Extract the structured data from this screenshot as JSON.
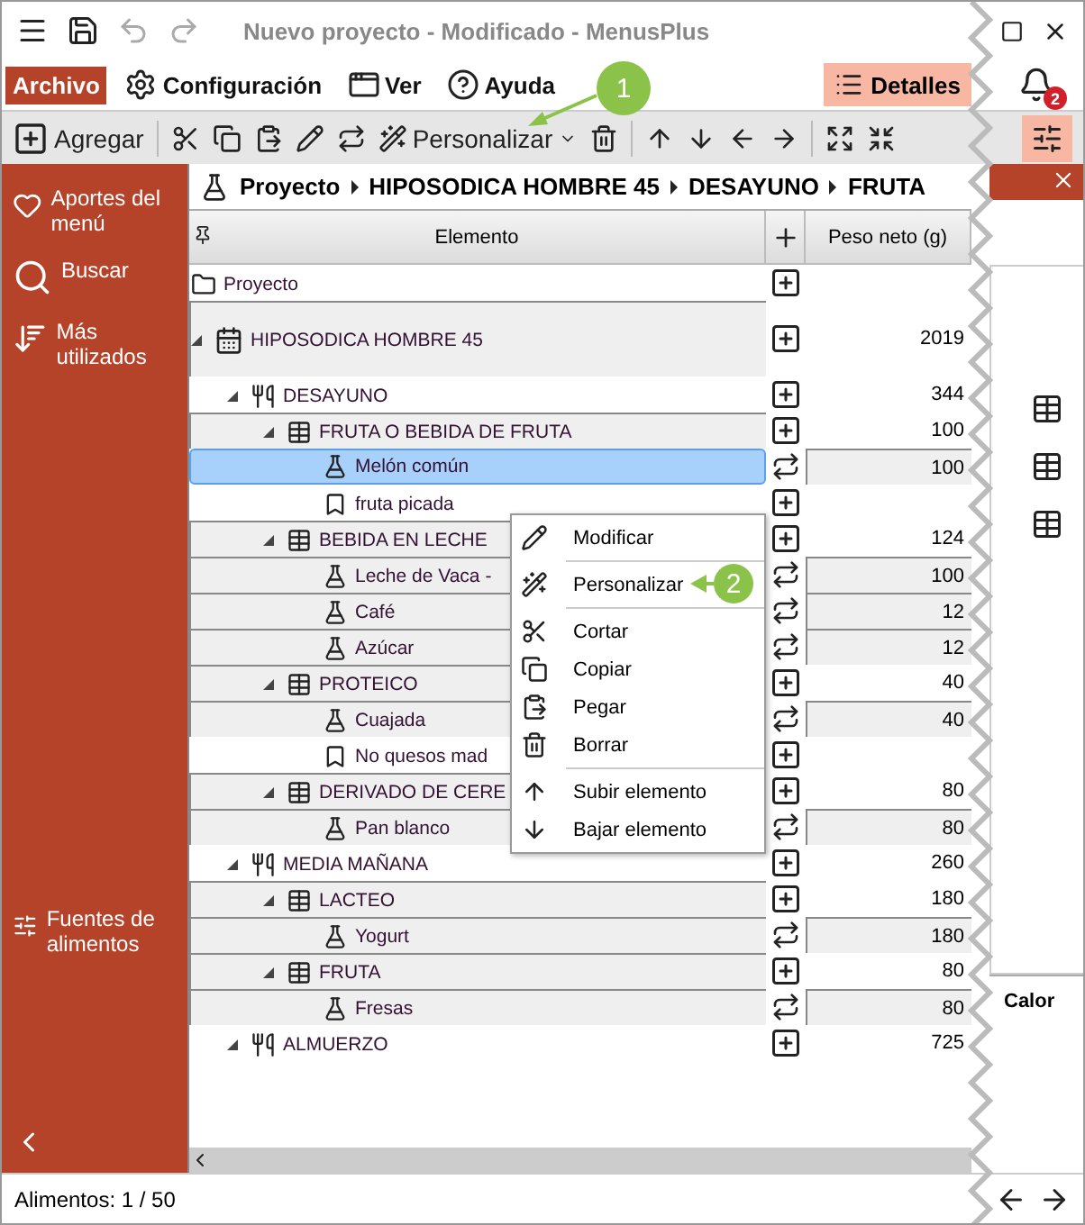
{
  "window": {
    "title": "Nuevo proyecto - Modificado - MenusPlus"
  },
  "menu_bar": {
    "items": [
      {
        "label": "Archivo",
        "selected": true
      },
      {
        "label": "Configuración",
        "selected": false
      },
      {
        "label": "Ver",
        "selected": false
      },
      {
        "label": "Ayuda",
        "selected": false
      }
    ],
    "details_button": {
      "label": "Detalles",
      "selected": true
    },
    "notifications_badge": "2"
  },
  "toolbar": {
    "add_label": "Agregar",
    "customize_label": "Personalizar",
    "settings_selected": true
  },
  "sidebar": {
    "items": [
      {
        "label": "Aportes del menú"
      },
      {
        "label": "Buscar"
      },
      {
        "label": "Más utilizados"
      }
    ],
    "bottom_item": {
      "label": "Fuentes de alimentos"
    }
  },
  "breadcrumb": [
    "Proyecto",
    "HIPOSODICA HOMBRE 45",
    "DESAYUNO",
    "FRUTA"
  ],
  "table": {
    "columns": [
      "Elemento",
      "Peso neto (g)"
    ],
    "rows": [
      {
        "kind": "project",
        "label": "Proyecto",
        "selected": false
      },
      {
        "kind": "menu",
        "label": "HIPOSODICA HOMBRE 45",
        "weight": "2019",
        "selected": false,
        "expanded": true,
        "children": [
          {
            "kind": "meal",
            "label": "DESAYUNO",
            "weight": "344",
            "selected": false,
            "expanded": true,
            "children": [
              {
                "kind": "group",
                "label": "FRUTA O BEBIDA DE FRUTA",
                "weight": "100",
                "selected": false,
                "expanded": true,
                "children": [
                  {
                    "kind": "food",
                    "label": "Melón común",
                    "weight": "100",
                    "selected": true
                  },
                  {
                    "kind": "note",
                    "label": "fruta picada",
                    "selected": false
                  }
                ]
              },
              {
                "kind": "group",
                "label": "BEBIDA EN LECHE",
                "weight": "124",
                "selected": false,
                "expanded": true,
                "children": [
                  {
                    "kind": "food",
                    "label": "Leche de Vaca -",
                    "weight": "100",
                    "selected": false
                  },
                  {
                    "kind": "food",
                    "label": "Café",
                    "weight": "12",
                    "selected": false
                  },
                  {
                    "kind": "food",
                    "label": "Azúcar",
                    "weight": "12",
                    "selected": false
                  }
                ]
              },
              {
                "kind": "group",
                "label": "PROTEICO",
                "weight": "40",
                "selected": false,
                "expanded": true,
                "children": [
                  {
                    "kind": "food",
                    "label": "Cuajada",
                    "weight": "40",
                    "selected": false
                  },
                  {
                    "kind": "note",
                    "label": "No quesos mad",
                    "selected": false
                  }
                ]
              },
              {
                "kind": "group",
                "label": "DERIVADO DE CERE",
                "weight": "80",
                "selected": false,
                "expanded": true,
                "children": [
                  {
                    "kind": "food",
                    "label": "Pan blanco",
                    "weight": "80",
                    "selected": false
                  }
                ]
              }
            ]
          },
          {
            "kind": "meal",
            "label": "MEDIA MAÑANA",
            "weight": "260",
            "selected": false,
            "expanded": true,
            "children": [
              {
                "kind": "group",
                "label": "LACTEO",
                "weight": "180",
                "selected": false,
                "expanded": true,
                "children": [
                  {
                    "kind": "food",
                    "label": "Yogurt",
                    "weight": "180",
                    "selected": false
                  }
                ]
              },
              {
                "kind": "group",
                "label": "FRUTA",
                "weight": "80",
                "selected": false,
                "expanded": true,
                "children": [
                  {
                    "kind": "food",
                    "label": "Fresas",
                    "weight": "80",
                    "selected": false
                  }
                ]
              }
            ]
          },
          {
            "kind": "meal",
            "label": "ALMUERZO",
            "weight": "725",
            "selected": false,
            "expanded": true
          }
        ]
      }
    ]
  },
  "context_menu": [
    {
      "label": "Modificar",
      "separator_after": true
    },
    {
      "label": "Personalizar",
      "separator_after": true
    },
    {
      "label": "Cortar",
      "separator_after": false
    },
    {
      "label": "Copiar",
      "separator_after": false
    },
    {
      "label": "Pegar",
      "separator_after": false
    },
    {
      "label": "Borrar",
      "separator_after": true
    },
    {
      "label": "Subir elemento",
      "separator_after": false
    },
    {
      "label": "Bajar elemento",
      "separator_after": false
    }
  ],
  "callouts": [
    "1",
    "2"
  ],
  "side_panel": {
    "column_1": "Calor"
  },
  "status_bar": "Alimentos: 1 / 50"
}
